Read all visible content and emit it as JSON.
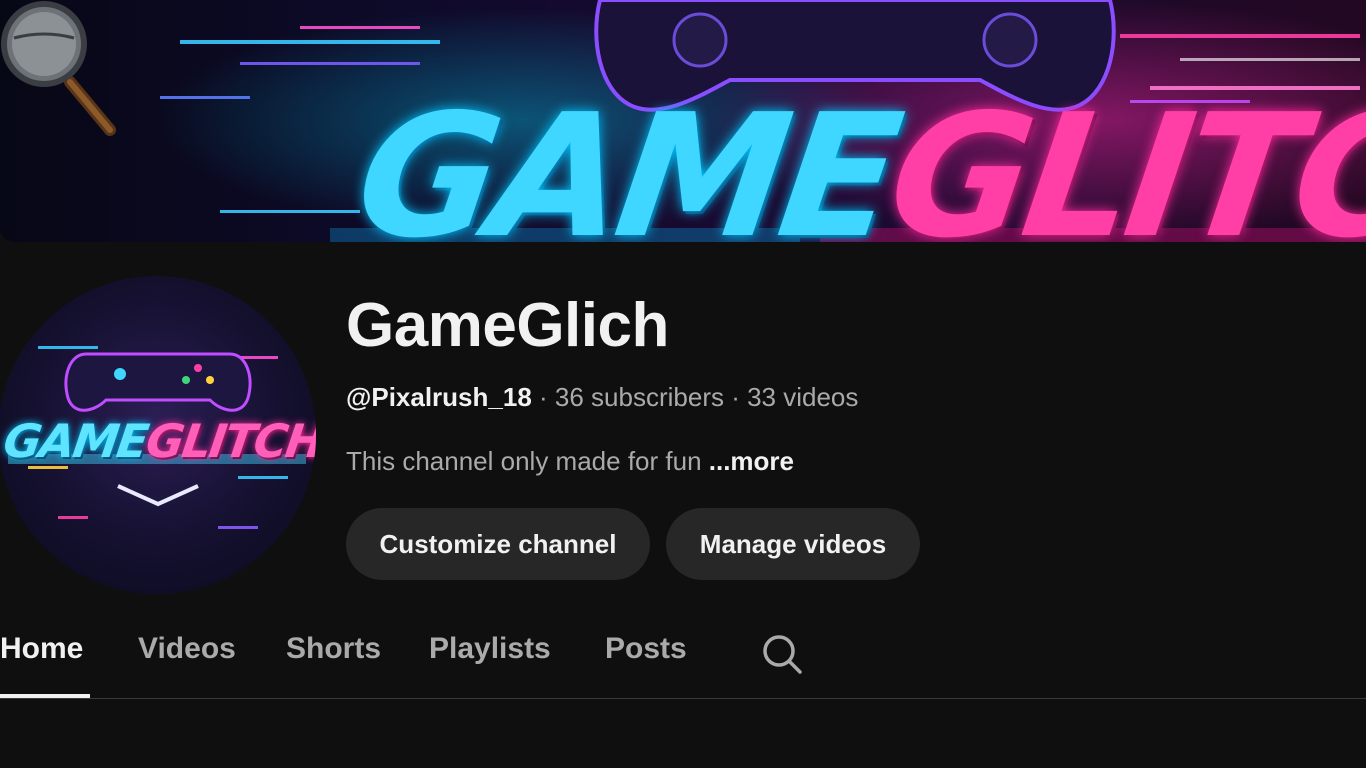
{
  "banner": {
    "title_part1": "GAME",
    "title_part2": "GLITCH"
  },
  "avatar": {
    "title_part1": "GAME",
    "title_part2": "GLITCH"
  },
  "channel": {
    "name": "GameGlich",
    "handle": "@Pixalrush_18",
    "subscribers": "36 subscribers",
    "videos": "33 videos",
    "separator": " · ",
    "description": "This channel only made for fun ",
    "more_label": "...more"
  },
  "actions": {
    "customize_label": "Customize channel",
    "manage_label": "Manage videos"
  },
  "tabs": [
    {
      "label": "Home",
      "active": true
    },
    {
      "label": "Videos",
      "active": false
    },
    {
      "label": "Shorts",
      "active": false
    },
    {
      "label": "Playlists",
      "active": false
    },
    {
      "label": "Posts",
      "active": false
    }
  ],
  "icons": {
    "banner_overlay": "magnifying-glass-icon",
    "tab_search": "search-icon"
  },
  "colors": {
    "background": "#0f0f0f",
    "button_bg": "#272727",
    "text_primary": "#f1f1f1",
    "text_secondary": "#aaaaaa",
    "accent_cyan": "#3fd6ff",
    "accent_pink": "#ff3fa6"
  }
}
